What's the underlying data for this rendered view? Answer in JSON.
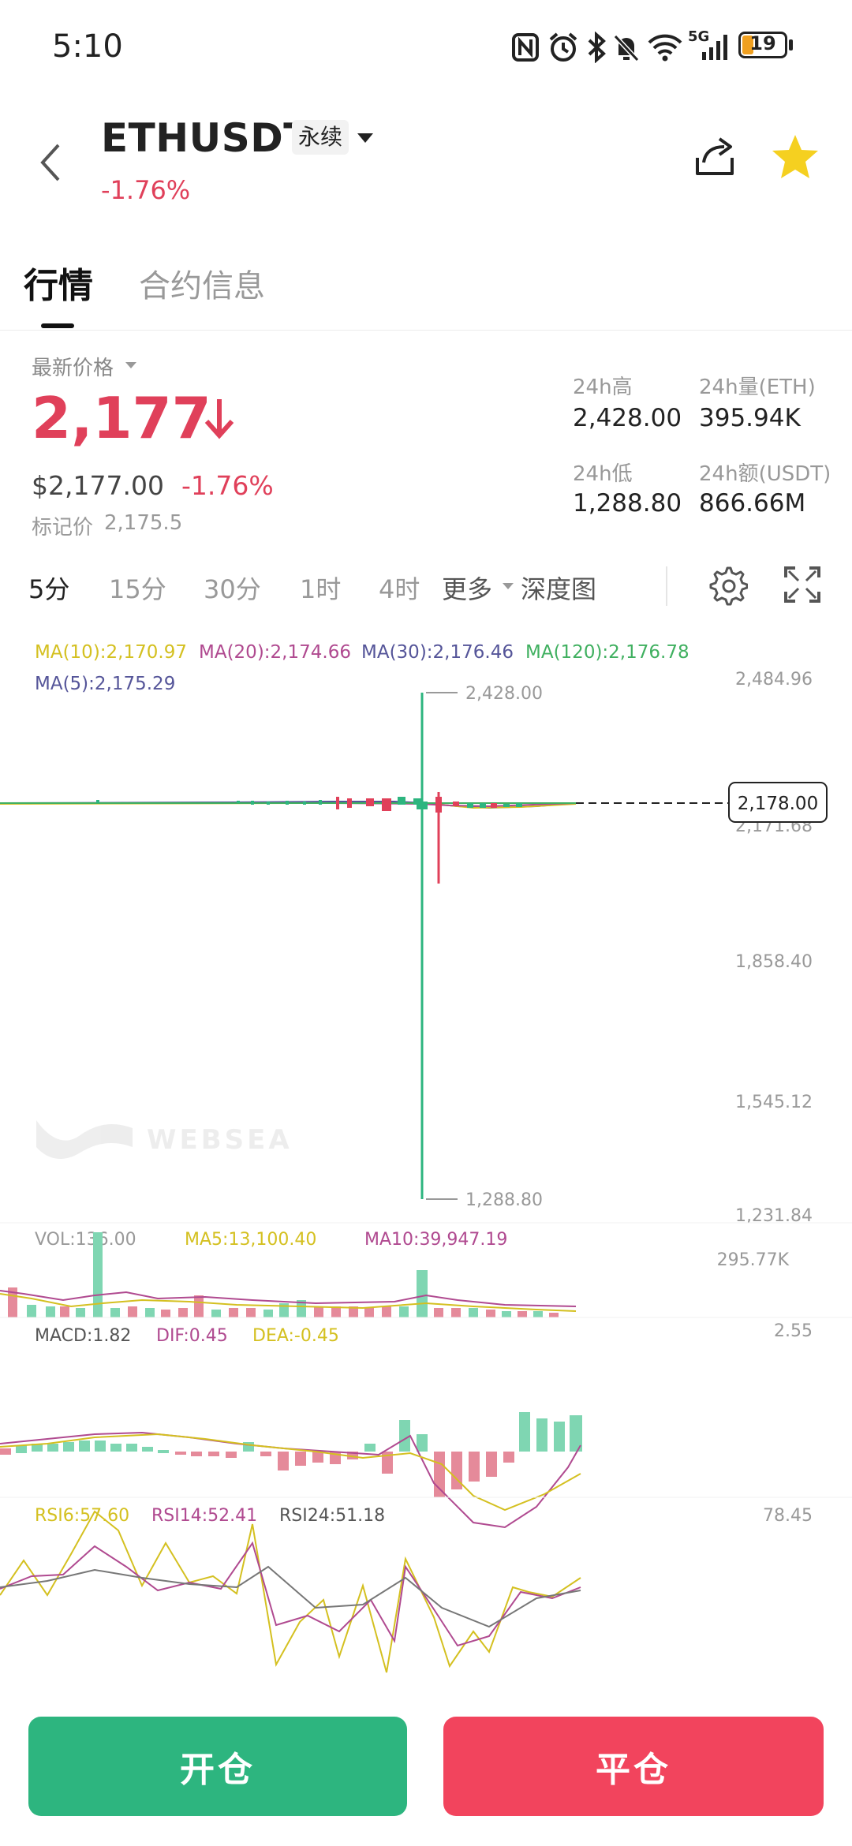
{
  "status_bar": {
    "time": "5:10",
    "battery": "19",
    "network": "5G",
    "icons": [
      "nfc-icon",
      "alarm-icon",
      "bluetooth-icon",
      "mute-icon",
      "wifi-icon",
      "signal-icon",
      "battery-icon"
    ]
  },
  "header": {
    "symbol": "ETHUSDT",
    "contract_type": "永续",
    "change": "-1.76%",
    "colors": {
      "down": "#e0405a",
      "up": "#2db57f",
      "favorite": "#f5d020"
    }
  },
  "tabs": [
    {
      "label": "行情",
      "active": true
    },
    {
      "label": "合约信息",
      "active": false
    }
  ],
  "price": {
    "label": "最新价格",
    "last": "2,177",
    "usd": "$2,177.00",
    "change": "-1.76%",
    "mark_label": "标记价",
    "mark_value": "2,175.5"
  },
  "stats": {
    "high_label": "24h高",
    "high": "2,428.00",
    "vol_label": "24h量(ETH)",
    "vol": "395.94K",
    "low_label": "24h低",
    "low": "1,288.80",
    "amount_label": "24h额(USDT)",
    "amount": "866.66M"
  },
  "timeframes": [
    "5分",
    "15分",
    "30分",
    "1时",
    "4时",
    "更多",
    "深度图"
  ],
  "chart": {
    "ma_labels": {
      "ma10": "MA(10):2,170.97",
      "ma20": "MA(20):2,174.66",
      "ma30": "MA(30):2,176.46",
      "ma120": "MA(120):2,176.78",
      "ma5": "MA(5):2,175.29"
    },
    "y_ticks": [
      "2,484.96",
      "2,171.68",
      "1,858.40",
      "1,545.12",
      "1,231.84"
    ],
    "high_marker": "2,428.00",
    "low_marker": "1,288.80",
    "current_price": "2,178.00",
    "watermark": "WEBSEA",
    "ma_colors": {
      "ma5": "#555599",
      "ma10": "#d4c020",
      "ma20": "#b04a90",
      "ma30": "#777777",
      "ma120": "#40b060"
    },
    "volume": {
      "vol": "VOL:136.00",
      "ma5": "MA5:13,100.40",
      "ma10": "MA10:39,947.19",
      "max": "295.77K"
    },
    "macd": {
      "macd": "MACD:1.82",
      "dif": "DIF:0.45",
      "dea": "DEA:-0.45",
      "max": "2.55"
    },
    "rsi": {
      "rsi6": "RSI6:57.60",
      "rsi14": "RSI14:52.41",
      "rsi24": "RSI24:51.18",
      "max": "78.45"
    }
  },
  "buttons": {
    "open": "开仓",
    "close": "平仓"
  }
}
